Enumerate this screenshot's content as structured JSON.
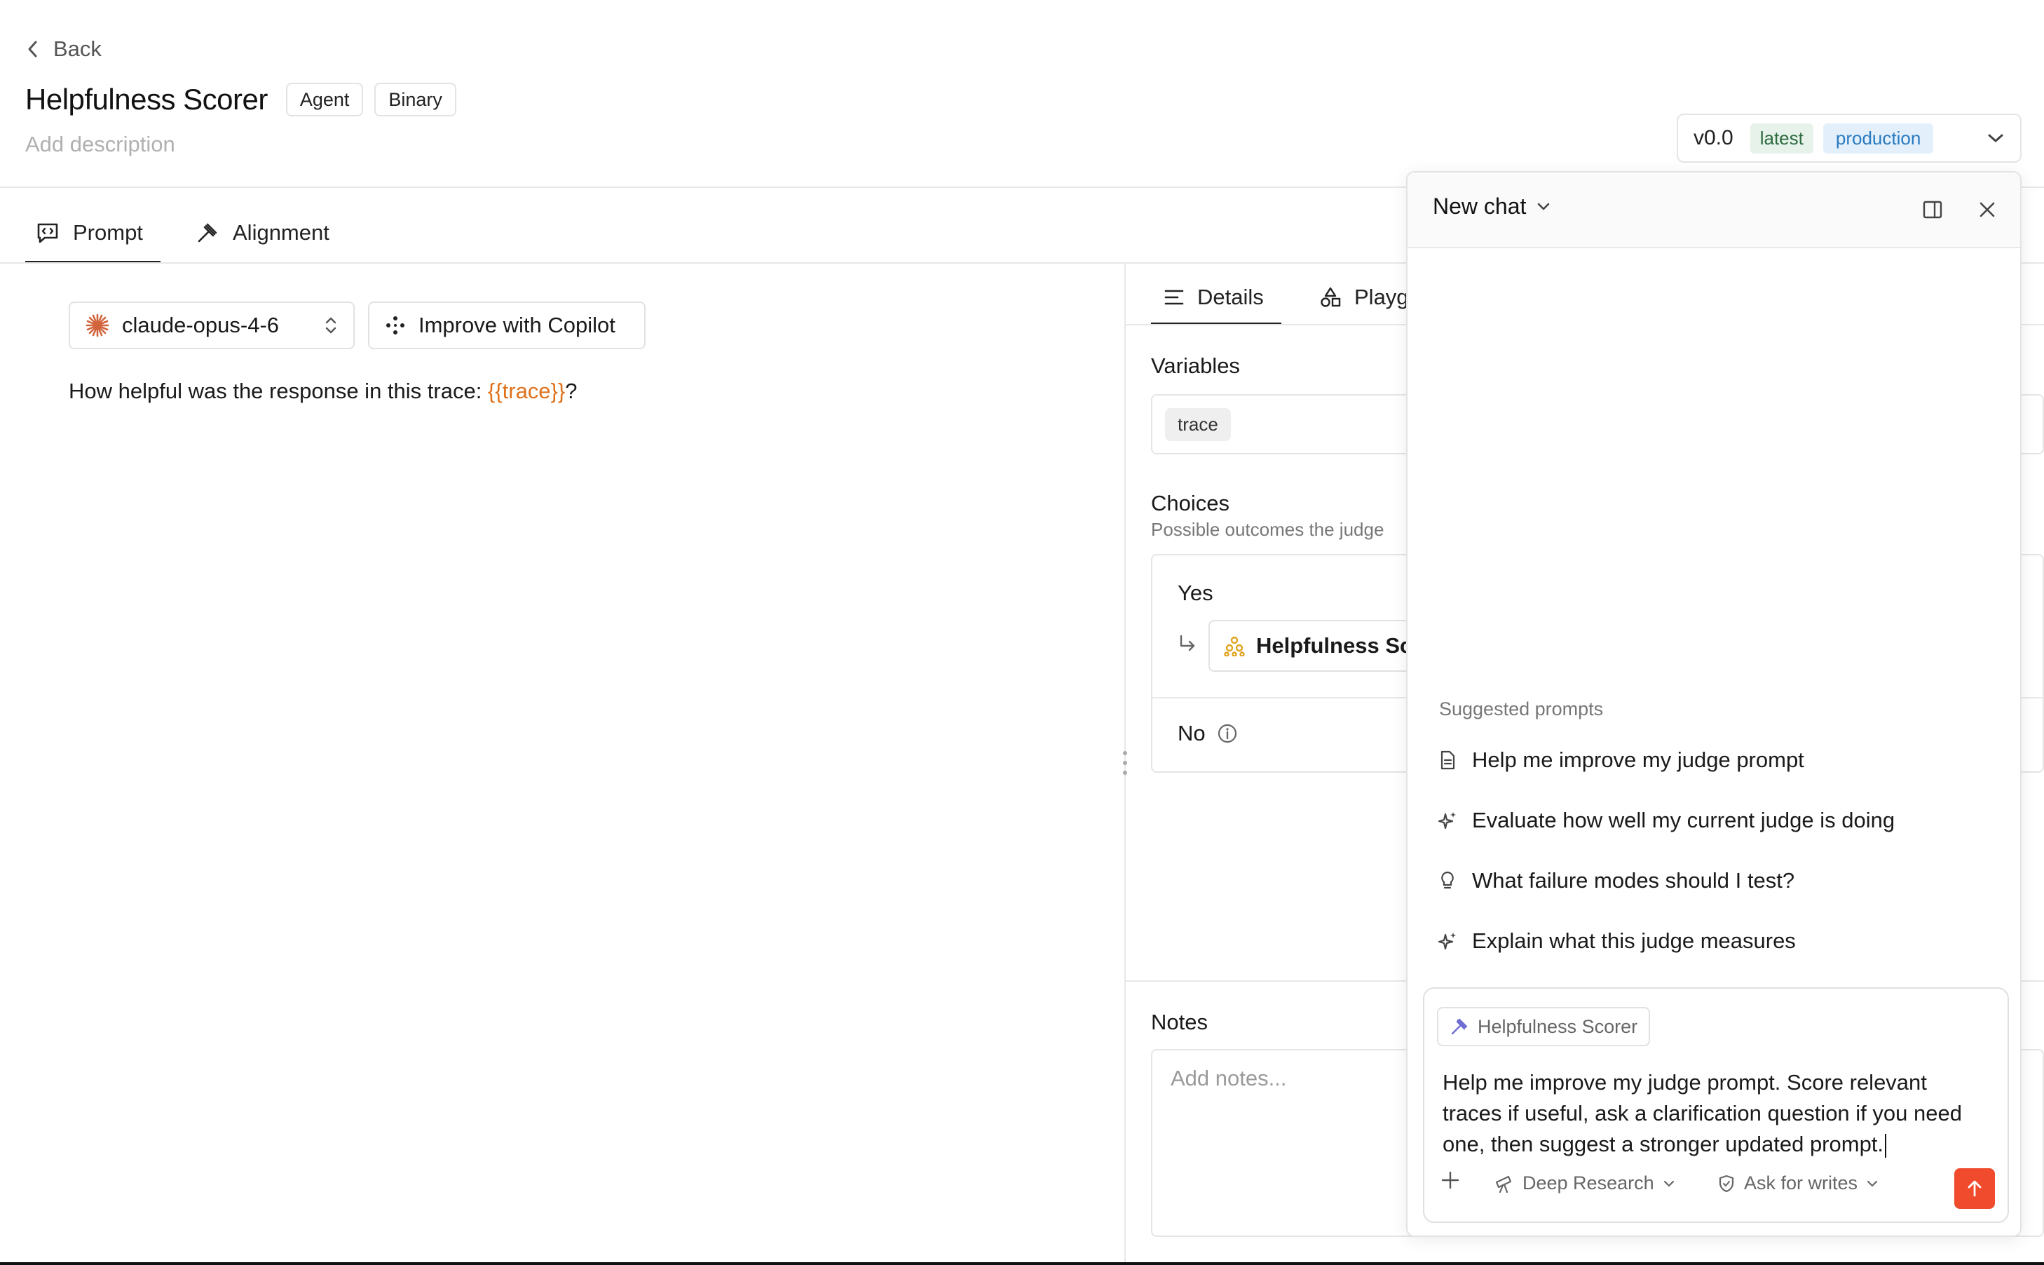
{
  "header": {
    "back_label": "Back",
    "title": "Helpfulness Scorer",
    "chips": [
      "Agent",
      "Binary"
    ],
    "description_placeholder": "Add description"
  },
  "version": {
    "label": "v0.0",
    "tags": [
      "latest",
      "production"
    ]
  },
  "tabs": [
    {
      "label": "Prompt",
      "icon": "prompt-icon",
      "active": true
    },
    {
      "label": "Alignment",
      "icon": "gavel-icon",
      "active": false
    }
  ],
  "editor": {
    "model": "claude-opus-4-6",
    "improve_label": "Improve with Copilot",
    "prompt_prefix": "How helpful was the response in this trace: ",
    "prompt_variable": "{{trace}}",
    "prompt_suffix": "?"
  },
  "details": {
    "tabs": [
      "Details",
      "Playg"
    ],
    "variables_title": "Variables",
    "variables": [
      "trace"
    ],
    "choices_title": "Choices",
    "choices_subtitle": "Possible outcomes the judge",
    "choices": [
      {
        "label": "Yes",
        "linked_judge": "Helpfulness Sc"
      },
      {
        "label": "No"
      }
    ],
    "notes_title": "Notes",
    "notes_placeholder": "Add notes..."
  },
  "chat": {
    "title": "New chat",
    "suggested_label": "Suggested prompts",
    "suggestions": [
      {
        "label": "Help me improve my judge prompt",
        "icon": "document-icon"
      },
      {
        "label": "Evaluate how well my current judge is doing",
        "icon": "sparkle-icon"
      },
      {
        "label": "What failure modes should I test?",
        "icon": "lightbulb-icon"
      },
      {
        "label": "Explain what this judge measures",
        "icon": "sparkle-icon"
      }
    ],
    "context_chip": "Helpfulness Scorer",
    "composer_text": "Help me improve my judge prompt. Score relevant traces if useful, ask a clarification question if you need one, then suggest a stronger updated prompt.",
    "tools": [
      "Deep Research",
      "Ask for writes"
    ]
  },
  "colors": {
    "accent": "#ef4b2c",
    "variable": "#e0711c",
    "latest_bg": "#e6f2ea",
    "production_bg": "#e3f0fb",
    "judge_icon": "#e0a21c"
  }
}
